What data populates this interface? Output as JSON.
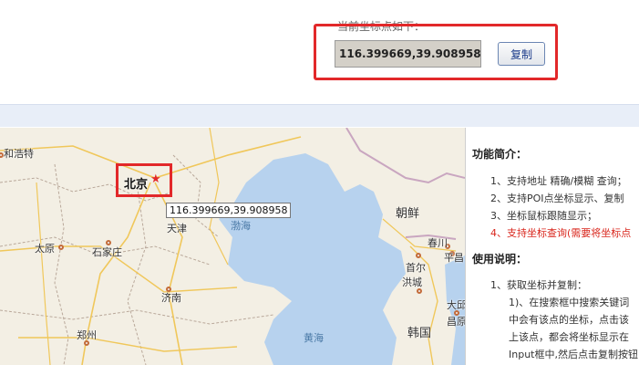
{
  "coord_panel": {
    "caption": "当前坐标点如下：",
    "value": "116.399669,39.908958",
    "copy_label": "复制"
  },
  "map": {
    "beijing": "北京",
    "tooltip": "116.399669,39.908958",
    "cities": [
      {
        "name": "和浩特"
      },
      {
        "name": "天津"
      },
      {
        "name": "太原"
      },
      {
        "name": "石家庄"
      },
      {
        "name": "济南"
      },
      {
        "name": "郑州"
      },
      {
        "name": "春川"
      },
      {
        "name": "首尔"
      },
      {
        "name": "平昌"
      },
      {
        "name": "洪城"
      },
      {
        "name": "大邱"
      },
      {
        "name": "昌原"
      }
    ],
    "regions": {
      "korea_n": "朝鲜",
      "korea_s": "韩国"
    },
    "seas": {
      "bohai": "渤海",
      "huanghai": "黄海"
    }
  },
  "info": {
    "intro_title": "功能简介：",
    "intro_items": [
      "1、支持地址 精确/模糊 查询；",
      "2、支持POI点坐标显示、复制",
      "3、坐标鼠标跟随显示；",
      "4、支持坐标查询(需要将坐标点"
    ],
    "usage_title": "使用说明：",
    "usage_items": [
      "1、获取坐标并复制：",
      "1)、在搜索框中搜索关键词",
      "中会有该点的坐标，点击该",
      "上该点，都会将坐标显示在",
      "Input框中,然后点击复制按钮"
    ]
  },
  "colors": {
    "highlight": "#e2282a",
    "band": "#e8eef8",
    "sea": "#b7d2ee",
    "land": "#f3efe4"
  }
}
